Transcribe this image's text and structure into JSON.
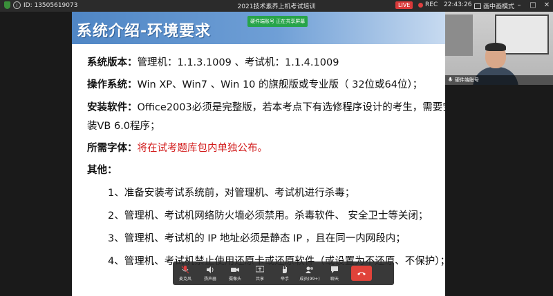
{
  "topbar": {
    "meeting_id": "ID: 13505619073",
    "title": "2021技术素养上机考试培训",
    "live_label": "LIVE",
    "rec_label": "REC",
    "clock": "22:43:26",
    "pip_label": "画中画模式"
  },
  "slide": {
    "title": "系统介绍-环境要求",
    "share_badge": "硬件端账号 正在共享屏幕",
    "version_label": "系统版本：",
    "version_value": "管理机：1.1.3.1009 、考试机：1.1.4.1009",
    "os_label": "操作系统：",
    "os_value": "Win XP、Win7 、Win 10 的旗舰版或专业版（ 32位或64位）；",
    "software_label": "安装软件：",
    "software_value": "Office2003必须是完整版，若本考点下有选修程序设计的考生，需要安",
    "software_cont": "装VB 6.0程序；",
    "font_label": "所需字体：",
    "font_value": "将在试考题库包内单独公布。",
    "other_label": "其他：",
    "items": [
      "1、准备安装考试系统前，对管理机、考试机进行杀毒；",
      "2、管理机、考试机网络防火墙必须禁用。杀毒软件、 安全卫士等关闭；",
      "3、管理机、考试机的 IP 地址必须是静态 IP ，且在同一内网段内；",
      "4、管理机、考试机禁止使用还原卡或还原软件（或设置为不还原、不保护）；"
    ]
  },
  "toolbar": {
    "mic": "麦克风",
    "speaker": "扬声器",
    "camera": "摄像头",
    "share": "共享",
    "raise_hand": "举手",
    "members": "成员(99+)",
    "chat": "聊天"
  },
  "camera_feed": {
    "name": "硬件端账号"
  },
  "colors": {
    "slide_header": "#4f86c5",
    "accent_red": "#d21b1b",
    "live": "#d93a3a",
    "hangup": "#e0433a",
    "share_badge": "#27a44a"
  }
}
